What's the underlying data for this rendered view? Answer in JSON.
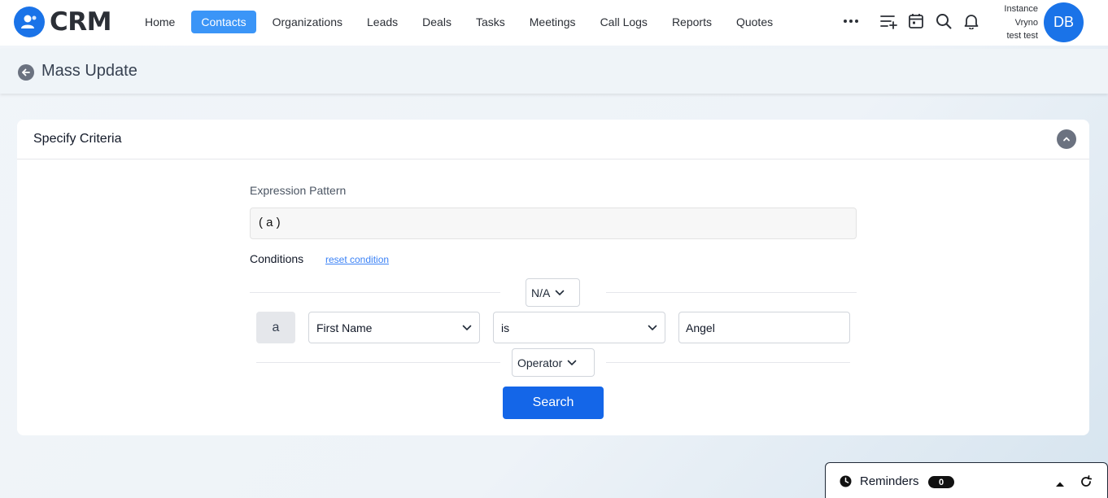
{
  "app": {
    "logo_text": "CRM"
  },
  "nav": {
    "items": [
      {
        "label": "Home",
        "active": false
      },
      {
        "label": "Contacts",
        "active": true
      },
      {
        "label": "Organizations",
        "active": false
      },
      {
        "label": "Leads",
        "active": false
      },
      {
        "label": "Deals",
        "active": false
      },
      {
        "label": "Tasks",
        "active": false
      },
      {
        "label": "Meetings",
        "active": false
      },
      {
        "label": "Call Logs",
        "active": false
      },
      {
        "label": "Reports",
        "active": false
      },
      {
        "label": "Quotes",
        "active": false
      }
    ],
    "more_icon": "more-horizontal-icon"
  },
  "top_icons": [
    "add-list-icon",
    "calendar-icon",
    "search-icon",
    "bell-icon"
  ],
  "user": {
    "line1": "Instance",
    "line2": "Vryno",
    "line3": "test test",
    "initials": "DB"
  },
  "page": {
    "title": "Mass Update"
  },
  "criteria": {
    "title": "Specify Criteria",
    "expression_label": "Expression Pattern",
    "expression_value": "( a )",
    "conditions_label": "Conditions",
    "reset_label": "reset condition",
    "group_select": "N/A",
    "condition": {
      "letter": "a",
      "field": "First Name",
      "operator": "is",
      "value": "Angel"
    },
    "operator_select": "Operator",
    "search_label": "Search"
  },
  "reminders": {
    "label": "Reminders",
    "count": "0"
  },
  "colors": {
    "accent": "#1a73e8",
    "active_tab": "#3b95f7",
    "button": "#1466e8"
  }
}
